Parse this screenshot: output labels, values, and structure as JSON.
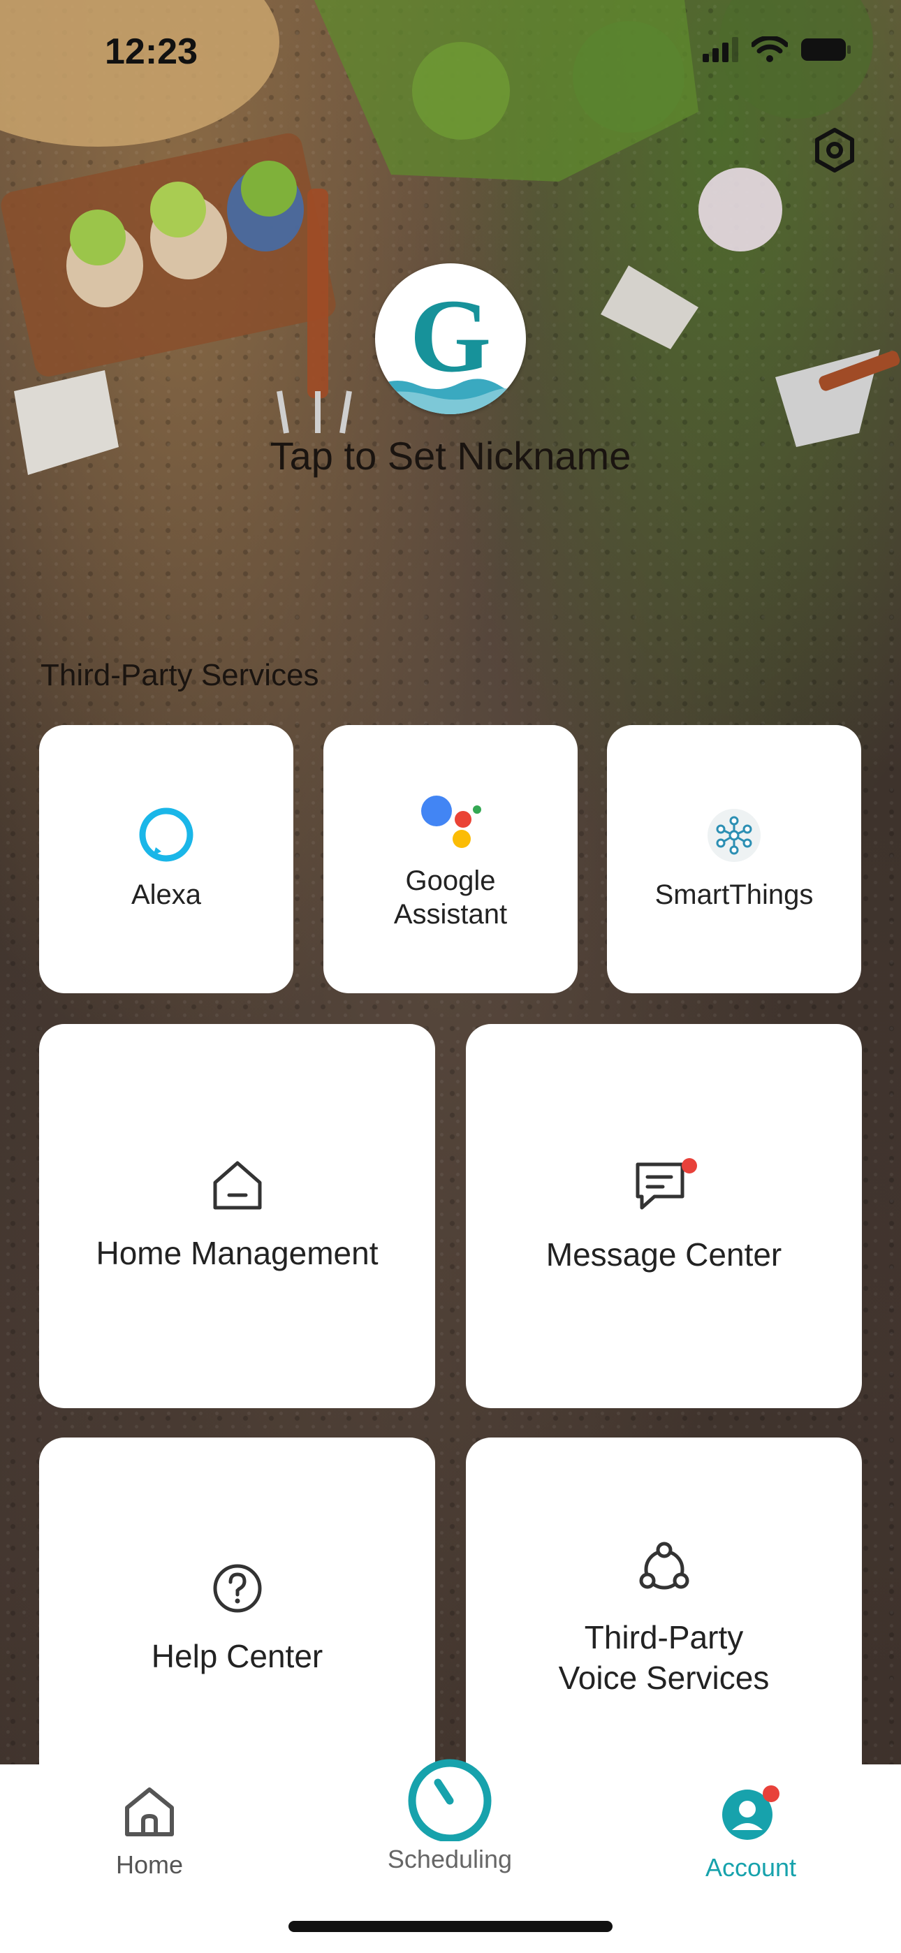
{
  "status_bar": {
    "time": "12:23"
  },
  "profile": {
    "avatar_letter": "G",
    "nickname_prompt": "Tap to Set Nickname"
  },
  "third_party": {
    "section_title": "Third-Party Services",
    "items": [
      {
        "label": "Alexa",
        "icon": "alexa-icon"
      },
      {
        "label": "Google Assistant",
        "icon": "google-assistant-icon"
      },
      {
        "label": "SmartThings",
        "icon": "smartthings-icon"
      }
    ]
  },
  "menu": {
    "home_management": "Home Management",
    "message_center": "Message Center",
    "help_center": "Help Center",
    "voice_services": "Third-Party Voice Services"
  },
  "nav": {
    "home": "Home",
    "scheduling": "Scheduling",
    "account": "Account",
    "active": "account"
  },
  "colors": {
    "accent": "#17A2AC",
    "badge": "#E8413A",
    "alexa": "#1AB6E8",
    "google_blue": "#4285F4",
    "google_red": "#EA4335",
    "google_yellow": "#FBBC05",
    "google_green": "#34A853"
  }
}
